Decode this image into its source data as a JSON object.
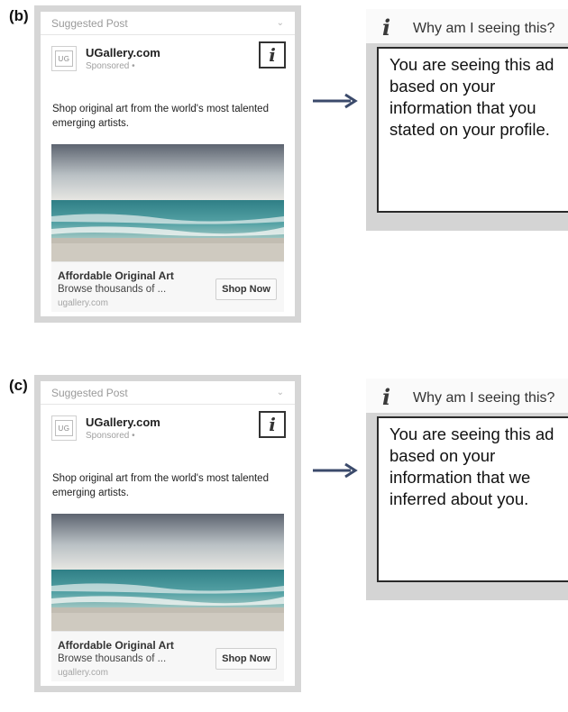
{
  "panels": [
    {
      "label": "(b)",
      "ad": {
        "header": "Suggested Post",
        "advertiser": "UGallery.com",
        "sponsored": "Sponsored",
        "logo_text": "UG",
        "info_icon": "i",
        "text": "Shop original art from the world's most talented emerging artists.",
        "cta_title": "Affordable Original Art",
        "cta_desc": "Browse thousands of ...",
        "cta_url": "ugallery.com",
        "cta_button": "Shop Now"
      },
      "explanation": {
        "icon": "i",
        "title": "Why am I seeing this?",
        "body": "You are seeing this ad based on your information that you stated on your profile."
      }
    },
    {
      "label": "(c)",
      "ad": {
        "header": "Suggested Post",
        "advertiser": "UGallery.com",
        "sponsored": "Sponsored",
        "logo_text": "UG",
        "info_icon": "i",
        "text": "Shop original art from the world's most talented emerging artists.",
        "cta_title": "Affordable Original Art",
        "cta_desc": "Browse thousands of ...",
        "cta_url": "ugallery.com",
        "cta_button": "Shop Now"
      },
      "explanation": {
        "icon": "i",
        "title": "Why am I seeing this?",
        "body": "You are seeing this ad based on your information that we inferred about you."
      }
    }
  ],
  "icons": {
    "chevron": "chevron-down-icon",
    "globe": "globe-icon",
    "info": "info-icon",
    "arrow": "arrow-right-icon",
    "image": "seascape-painting-image"
  },
  "colors": {
    "frame": "#d6d6d6",
    "arrow": "#3b4a6b",
    "text": "#222222"
  }
}
